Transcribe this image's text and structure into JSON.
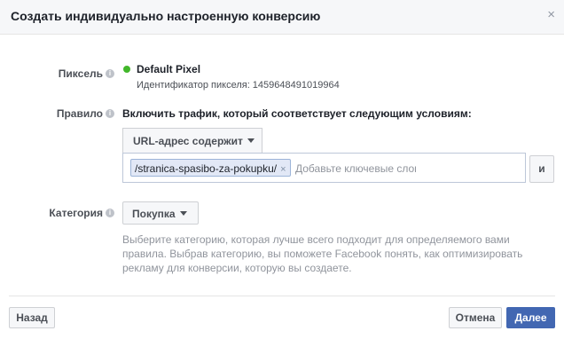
{
  "dialog": {
    "title": "Создать индивидуально настроенную конверсию",
    "close_label": "×"
  },
  "pixel": {
    "label": "Пиксель",
    "status_color": "#42b72a",
    "name": "Default Pixel",
    "id_text": "Идентификатор пикселя: 1459648491019964"
  },
  "rule": {
    "label": "Правило",
    "description": "Включить трафик, который соответствует следующим условиям:",
    "condition_select": "URL-адрес содержит",
    "token_value": "/stranica-spasibo-za-pokupku/",
    "token_remove": "×",
    "keyword_placeholder": "Добавьте ключевые слова",
    "or_button": "и"
  },
  "category": {
    "label": "Категория",
    "selected": "Покупка",
    "help": "Выберите категорию, которая лучше всего подходит для определяемого вами правила. Выбрав категорию, вы поможете Facebook понять, как оптимизировать рекламу для конверсии, которую вы создаете."
  },
  "footer": {
    "back_label": "Назад",
    "cancel_label": "Отмена",
    "next_label": "Далее"
  },
  "icons": {
    "info": "i",
    "info_icon_name": "info-icon",
    "caret_icon_name": "chevron-down-icon"
  },
  "colors": {
    "accent": "#4267b2",
    "token_bg": "#e2e8f6"
  }
}
